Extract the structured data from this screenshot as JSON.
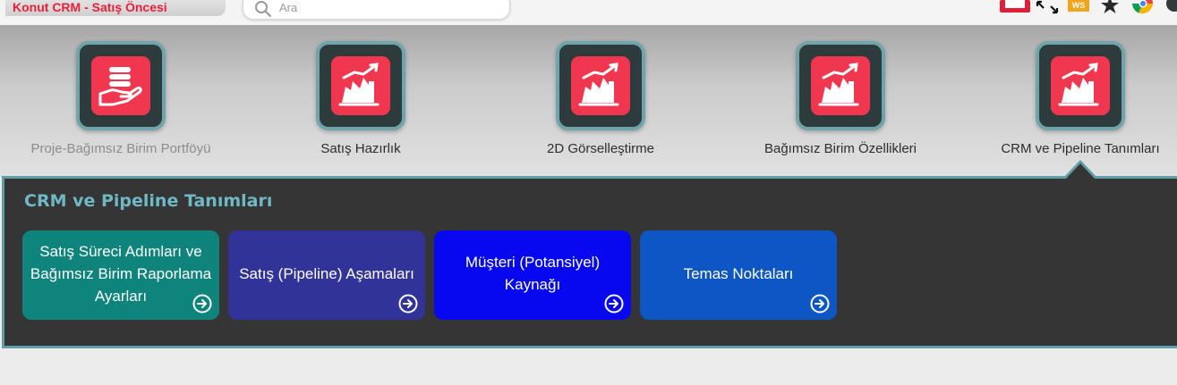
{
  "app": {
    "title": "Konut CRM - Satış Öncesi"
  },
  "search": {
    "placeholder": "Ara"
  },
  "toolbar_icons": [
    "record-icon",
    "expand-icon",
    "ws-extension-icon",
    "star-icon",
    "chrome-extension-icon",
    "profile-icon"
  ],
  "extension_badge": "WS",
  "modules": [
    {
      "label": "Proje-Bağımsız Birim Portföyü",
      "icon": "hand-coins-icon",
      "state": "dim"
    },
    {
      "label": "Satış Hazırlık",
      "icon": "sales-chart-icon",
      "state": "normal"
    },
    {
      "label": "2D Görselleştirme",
      "icon": "sales-chart-icon",
      "state": "normal"
    },
    {
      "label": "Bağımsız Birim Özellikleri",
      "icon": "sales-chart-icon",
      "state": "normal"
    },
    {
      "label": "CRM ve Pipeline Tanımları",
      "icon": "sales-chart-icon",
      "state": "active"
    }
  ],
  "panel": {
    "title": "CRM ve Pipeline Tanımları",
    "cards": [
      {
        "label": "Satış Süreci Adımları ve Bağımsız Birim Raporlama Ayarları",
        "color": "#0e847c"
      },
      {
        "label": "Satış (Pipeline) Aşamaları",
        "color": "#323399"
      },
      {
        "label": "Müşteri (Potansiyel) Kaynağı",
        "color": "#0808f0"
      },
      {
        "label": "Temas Noktaları",
        "color": "#0d56c4"
      }
    ]
  },
  "colors": {
    "brand_red": "#e8203a",
    "tile_face": "#f0374f",
    "panel_border": "#5e9ea6",
    "panel_title": "#6eb9c4"
  }
}
